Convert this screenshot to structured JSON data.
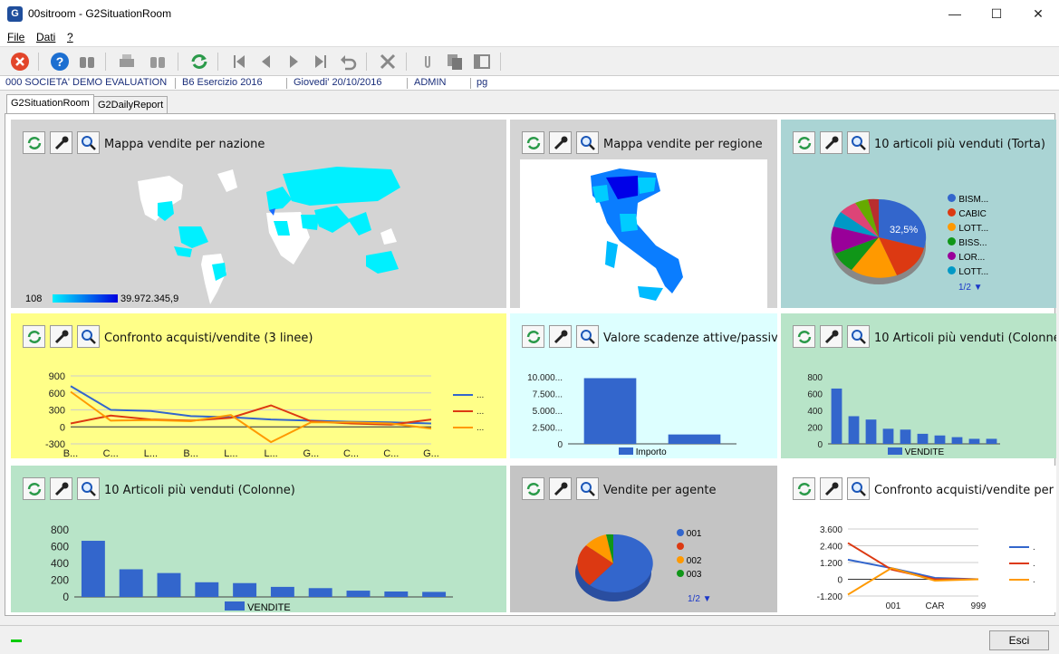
{
  "window": {
    "title": "00sitroom - G2SituationRoom",
    "app_icon": "G"
  },
  "menu": [
    "File",
    "Dati",
    "?"
  ],
  "status": [
    "000 SOCIETA' DEMO EVALUATION",
    "B6 Esercizio 2016",
    "Giovedi' 20/10/2016",
    "ADMIN",
    "pg"
  ],
  "tabs": [
    "G2SituationRoom",
    "G2DailyReport"
  ],
  "panels": {
    "p1": {
      "title": "Mappa vendite per nazione",
      "legend_min": "108",
      "legend_max": "39.972.345,9"
    },
    "p2": {
      "title": "Mappa vendite per regione"
    },
    "p3": {
      "title": "10 articoli più venduti (Torta)",
      "legend": [
        "BISM...",
        "CABIC",
        "LOTT...",
        "BISS...",
        "LOR...",
        "LOTT..."
      ],
      "pct": "32,5%",
      "pager": "1/2"
    },
    "p4": {
      "title": "Confronto acquisti/vendite (3 linee)",
      "series_labels": [
        "...",
        "...",
        "..."
      ]
    },
    "p5": {
      "title": "Valore scadenze attive/passive",
      "legend": "Importo"
    },
    "p6": {
      "title": "10 Articoli più venduti (Colonne)",
      "legend": "VENDITE"
    },
    "p7": {
      "title": "10 Articoli più venduti (Colonne)",
      "legend": "VENDITE"
    },
    "p8": {
      "title": "Vendite per agente",
      "legend": [
        "001",
        "",
        "002",
        "003"
      ],
      "pager": "1/2"
    },
    "p9": {
      "title": "Confronto acquisti/vendite per",
      "series_labels": [
        ".",
        ".",
        "."
      ]
    }
  },
  "colors": {
    "red": "#d23b1b",
    "blue": "#3366cc",
    "orange": "#ff9900",
    "green": "#109618",
    "purple": "#990099",
    "teal": "#0099c6"
  },
  "chart_data": [
    {
      "id": "lines3",
      "type": "line",
      "categories": [
        "B...",
        "C...",
        "L...",
        "B...",
        "L...",
        "L...",
        "G...",
        "C...",
        "C...",
        "G..."
      ],
      "ylim": [
        -300,
        900
      ],
      "yticks": [
        "900",
        "600",
        "300",
        "0",
        "-300"
      ],
      "series": [
        {
          "color": "#3366cc",
          "values": [
            720,
            300,
            280,
            190,
            170,
            130,
            110,
            90,
            80,
            60
          ]
        },
        {
          "color": "#dc3912",
          "values": [
            60,
            200,
            130,
            110,
            160,
            380,
            100,
            60,
            40,
            130
          ]
        },
        {
          "color": "#ff9900",
          "values": [
            620,
            110,
            120,
            100,
            210,
            -270,
            80,
            80,
            60,
            -30
          ]
        }
      ]
    },
    {
      "id": "scadenze",
      "type": "bar",
      "categories": [
        "",
        ""
      ],
      "values": [
        9800,
        1400
      ],
      "ylim": [
        0,
        10000
      ],
      "yticks": [
        "10.000...",
        "7.500...",
        "5.000...",
        "2.500...",
        "0"
      ]
    },
    {
      "id": "cols_small",
      "type": "bar",
      "values": [
        660,
        330,
        290,
        180,
        170,
        120,
        100,
        80,
        60,
        60
      ],
      "ylim": [
        0,
        800
      ],
      "yticks": [
        "800",
        "600",
        "400",
        "200",
        "0"
      ]
    },
    {
      "id": "cols_big",
      "type": "bar",
      "values": [
        670,
        330,
        285,
        175,
        165,
        120,
        105,
        75,
        65,
        60
      ],
      "ylim": [
        0,
        800
      ],
      "yticks": [
        "800",
        "600",
        "400",
        "200",
        "0"
      ]
    },
    {
      "id": "lines_small",
      "type": "line",
      "categories": [
        "001",
        "CAR",
        "999"
      ],
      "ylim": [
        -1200,
        3600
      ],
      "yticks": [
        "3.600",
        "2.400",
        "1.200",
        "0",
        "-1.200"
      ],
      "series": [
        {
          "color": "#3366cc",
          "values": [
            1400,
            800,
            100,
            0
          ]
        },
        {
          "color": "#dc3912",
          "values": [
            2600,
            700,
            0,
            0
          ]
        },
        {
          "color": "#ff9900",
          "values": [
            -1100,
            800,
            -100,
            0
          ]
        }
      ]
    }
  ]
}
